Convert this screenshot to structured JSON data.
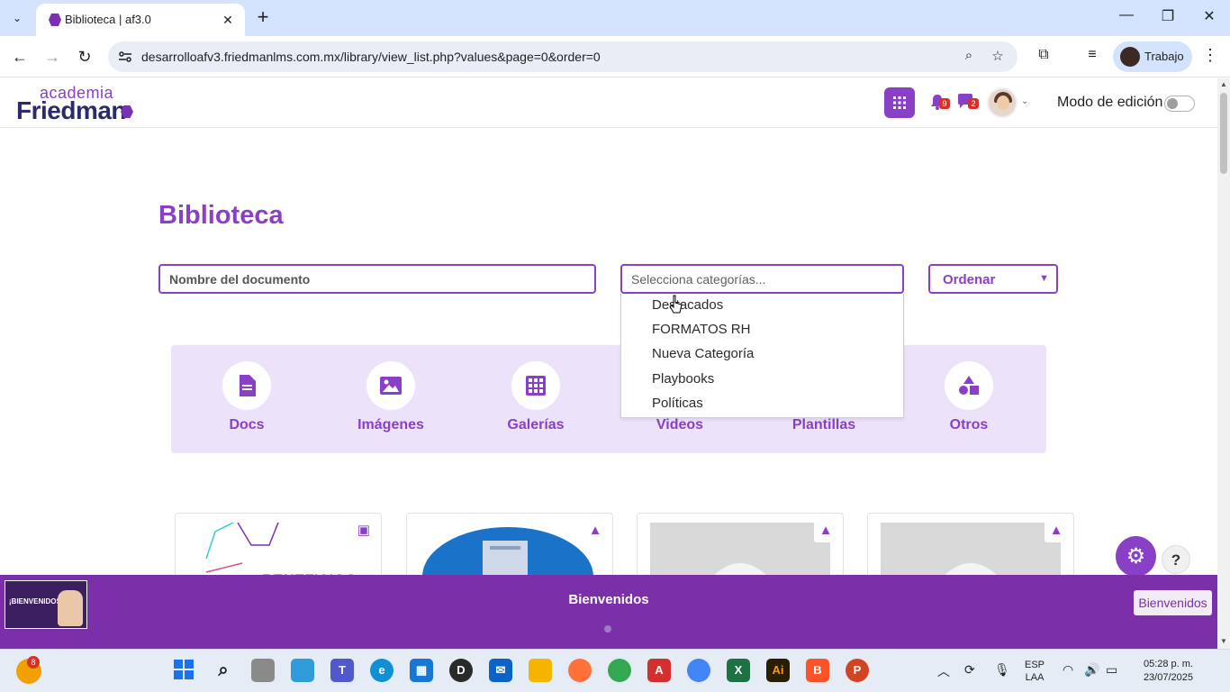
{
  "browser": {
    "tab_title": "Biblioteca | af3.0",
    "url": "desarrolloafv3.friedmanlms.com.mx/library/view_list.php?values&page=0&order=0",
    "profile_label": "Trabajo"
  },
  "header": {
    "logo_top": "academia",
    "logo_main": "Friedman",
    "notif_count": "9",
    "chat_count": "2",
    "edit_mode_label": "Modo de edición"
  },
  "main": {
    "title": "Biblioteca",
    "doc_placeholder": "Nombre del documento",
    "category_placeholder": "Selecciona categorías...",
    "order_label": "Ordenar",
    "category_options": [
      "Destacados",
      "FORMATOS RH",
      "Nueva Categoría",
      "Playbooks",
      "Políticas"
    ],
    "categories": [
      {
        "label": "Docs",
        "icon": "file-icon"
      },
      {
        "label": "Imágenes",
        "icon": "image-icon"
      },
      {
        "label": "Galerías",
        "icon": "grid-icon"
      },
      {
        "label": "Videos",
        "icon": "video-icon"
      },
      {
        "label": "Plantillas",
        "icon": "template-icon"
      },
      {
        "label": "Otros",
        "icon": "shapes-icon"
      }
    ],
    "card_text": "BENEFICIOS"
  },
  "banner": {
    "thumb_text": "¡BIENVENIDOS!",
    "title": "Bienvenidos",
    "button_label": "Bienvenidos"
  },
  "taskbar": {
    "weather_badge": "8",
    "lang_top": "ESP",
    "lang_bottom": "LAA",
    "time": "05:28 p. m.",
    "date": "23/07/2025"
  },
  "colors": {
    "brand_purple": "#8a3fc7",
    "banner_purple": "#7b2fa8",
    "panel_lavender": "#ece2fa"
  }
}
